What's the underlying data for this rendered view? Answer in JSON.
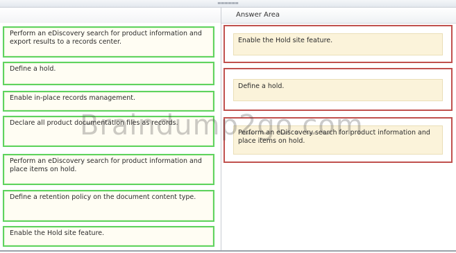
{
  "answer_area": {
    "title": "Answer Area",
    "targets": [
      "Enable the Hold site feature.",
      "Define a hold.",
      "Perform an eDiscovery search for product information and place items on hold."
    ]
  },
  "options": [
    "Perform an eDiscovery search for product information and export results to a records center.",
    "Define a hold.",
    "Enable in-place records management.",
    "Declare all product documentation files as records.",
    "Perform an eDiscovery search for product information and place items on hold.",
    "Define a retention policy on the document content type.",
    "Enable the Hold site feature."
  ],
  "watermark": "Braindump2go.com",
  "colors": {
    "option_border": "#5fd35f",
    "target_border": "#c0504d",
    "slot_fill": "#fbf3da"
  }
}
